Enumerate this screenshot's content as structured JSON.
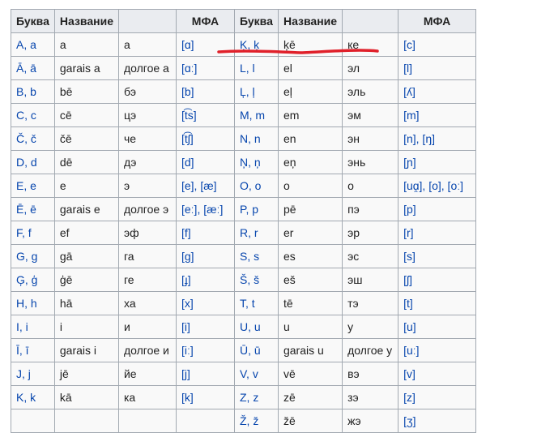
{
  "headers": [
    "Буква",
    "Название",
    "",
    "МФА",
    "Буква",
    "Название",
    "",
    "МФА"
  ],
  "rows": [
    {
      "l_letter": "A, a",
      "l_name": "a",
      "l_ru": "а",
      "l_ipa": "[ɑ]",
      "r_letter": "Ķ, ķ",
      "r_name": "ķē",
      "r_ru": "ке",
      "r_ipa": "[c]"
    },
    {
      "l_letter": "Ā, ā",
      "l_name": "garais a",
      "l_ru": "долгое а",
      "l_ipa": "[ɑː]",
      "r_letter": "L, l",
      "r_name": "el",
      "r_ru": "эл",
      "r_ipa": "[l]"
    },
    {
      "l_letter": "B, b",
      "l_name": "bē",
      "l_ru": "бэ",
      "l_ipa": "[b]",
      "r_letter": "Ļ, ļ",
      "r_name": "eļ",
      "r_ru": "эль",
      "r_ipa": "[ʎ]"
    },
    {
      "l_letter": "C, c",
      "l_name": "cē",
      "l_ru": "цэ",
      "l_ipa": "[t͡s]",
      "r_letter": "M, m",
      "r_name": "em",
      "r_ru": "эм",
      "r_ipa": "[m]"
    },
    {
      "l_letter": "Č, č",
      "l_name": "čē",
      "l_ru": "че",
      "l_ipa": "[t͡ʃ]",
      "r_letter": "N, n",
      "r_name": "en",
      "r_ru": "эн",
      "r_ipa": "[n], [ŋ]"
    },
    {
      "l_letter": "D, d",
      "l_name": "dē",
      "l_ru": "дэ",
      "l_ipa": "[d]",
      "r_letter": "Ņ, ņ",
      "r_name": "eņ",
      "r_ru": "энь",
      "r_ipa": "[ɲ]"
    },
    {
      "l_letter": "E, e",
      "l_name": "e",
      "l_ru": "э",
      "l_ipa": "[e], [æ]",
      "r_letter": "O, o",
      "r_name": "o",
      "r_ru": "о",
      "r_ipa": "[uɑ̯], [o], [oː]"
    },
    {
      "l_letter": "Ē, ē",
      "l_name": "garais e",
      "l_ru": "долгое э",
      "l_ipa": "[eː], [æː]",
      "r_letter": "P, p",
      "r_name": "pē",
      "r_ru": "пэ",
      "r_ipa": "[p]"
    },
    {
      "l_letter": "F, f",
      "l_name": "ef",
      "l_ru": "эф",
      "l_ipa": "[f]",
      "r_letter": "R, r",
      "r_name": "er",
      "r_ru": "эр",
      "r_ipa": "[r]"
    },
    {
      "l_letter": "G, g",
      "l_name": "gā",
      "l_ru": "га",
      "l_ipa": "[g]",
      "r_letter": "S, s",
      "r_name": "es",
      "r_ru": "эс",
      "r_ipa": "[s]"
    },
    {
      "l_letter": "Ģ, ģ",
      "l_name": "ģē",
      "l_ru": "ге",
      "l_ipa": "[ɟ]",
      "r_letter": "Š, š",
      "r_name": "eš",
      "r_ru": "эш",
      "r_ipa": "[ʃ]"
    },
    {
      "l_letter": "H, h",
      "l_name": "hā",
      "l_ru": "ха",
      "l_ipa": "[x]",
      "r_letter": "T, t",
      "r_name": "tē",
      "r_ru": "тэ",
      "r_ipa": "[t]"
    },
    {
      "l_letter": "I, i",
      "l_name": "i",
      "l_ru": "и",
      "l_ipa": "[i]",
      "r_letter": "U, u",
      "r_name": "u",
      "r_ru": "у",
      "r_ipa": "[u]"
    },
    {
      "l_letter": "Ī, ī",
      "l_name": "garais i",
      "l_ru": "долгое и",
      "l_ipa": "[iː]",
      "r_letter": "Ū, ū",
      "r_name": "garais u",
      "r_ru": "долгое у",
      "r_ipa": "[uː]"
    },
    {
      "l_letter": "J, j",
      "l_name": "jē",
      "l_ru": "йе",
      "l_ipa": "[j]",
      "r_letter": "V, v",
      "r_name": "vē",
      "r_ru": "вэ",
      "r_ipa": "[v]"
    },
    {
      "l_letter": "K, k",
      "l_name": "kā",
      "l_ru": "ка",
      "l_ipa": "[k]",
      "r_letter": "Z, z",
      "r_name": "zē",
      "r_ru": "зэ",
      "r_ipa": "[z]"
    },
    {
      "l_letter": "",
      "l_name": "",
      "l_ru": "",
      "l_ipa": "",
      "r_letter": "Ž, ž",
      "r_name": "žē",
      "r_ru": "жэ",
      "r_ipa": "[ʒ]"
    }
  ],
  "annotation_color": "#e0202a"
}
